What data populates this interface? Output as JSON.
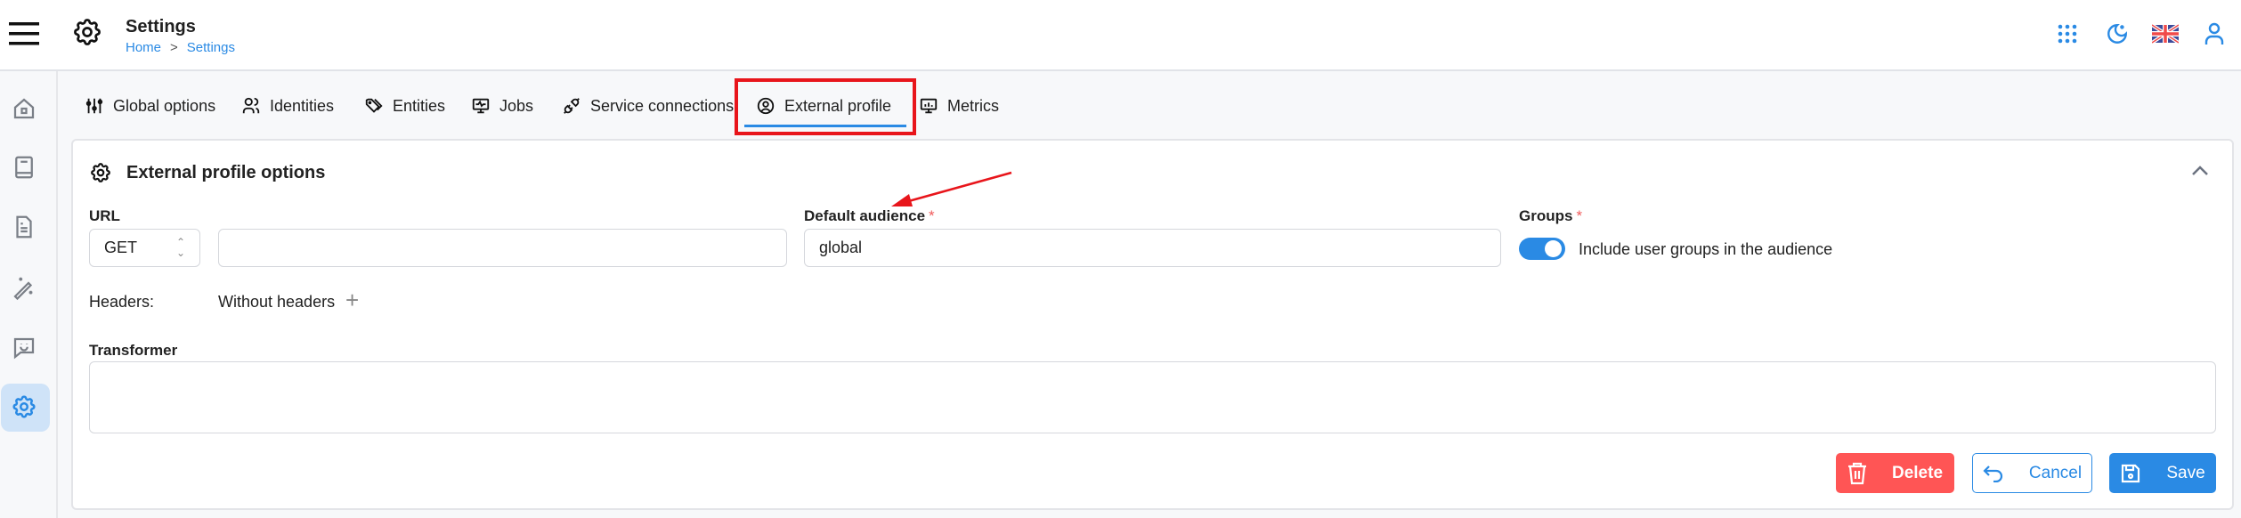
{
  "header": {
    "title": "Settings",
    "breadcrumb": [
      "Home",
      ">",
      "Settings"
    ],
    "icons": [
      "apps-grid-icon",
      "moon-icon",
      "uk-flag-icon",
      "user-icon"
    ]
  },
  "sidebar": {
    "items": [
      {
        "icon": "home-icon"
      },
      {
        "icon": "book-icon"
      },
      {
        "icon": "document-icon"
      },
      {
        "icon": "magic-wand-icon"
      },
      {
        "icon": "chat-smile-icon"
      },
      {
        "icon": "gear-icon",
        "active": true
      }
    ]
  },
  "tabs": [
    {
      "label": "Global options",
      "icon": "sliders-icon"
    },
    {
      "label": "Identities",
      "icon": "users-icon"
    },
    {
      "label": "Entities",
      "icon": "tags-icon"
    },
    {
      "label": "Jobs",
      "icon": "monitor-icon"
    },
    {
      "label": "Service connections",
      "icon": "plug-icon"
    },
    {
      "label": "External profile",
      "icon": "user-circle-icon",
      "active": true
    },
    {
      "label": "Metrics",
      "icon": "chart-monitor-icon"
    }
  ],
  "card": {
    "title": "External profile options",
    "url": {
      "label": "URL",
      "method": "GET",
      "value": ""
    },
    "audience": {
      "label": "Default audience",
      "required": "*",
      "value": "global"
    },
    "groups": {
      "label": "Groups",
      "required": "*",
      "toggle_label": "Include user groups in the audience",
      "enabled": true
    },
    "headers": {
      "label": "Headers:",
      "value": "Without headers"
    },
    "transformer": {
      "label": "Transformer",
      "value": ""
    },
    "buttons": {
      "delete": "Delete",
      "cancel": "Cancel",
      "save": "Save"
    }
  },
  "colors": {
    "accent": "#2a8ae4",
    "danger": "#ff5555",
    "annotation": "#e8151b"
  }
}
